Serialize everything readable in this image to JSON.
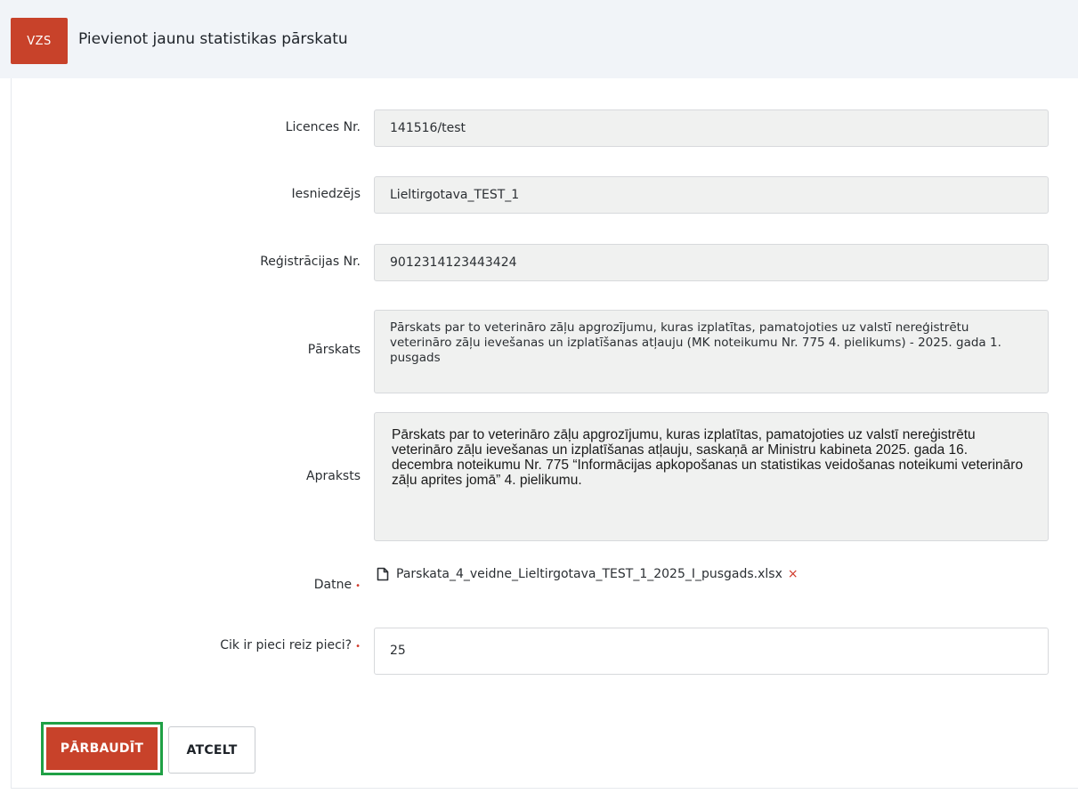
{
  "header": {
    "logo_text": "VZS",
    "title": "Pievienot jaunu statistikas pārskatu"
  },
  "form": {
    "licence": {
      "label": "Licences Nr.",
      "value": "141516/test"
    },
    "submitter": {
      "label": "Iesniedzējs",
      "value": "Lieltirgotava_TEST_1"
    },
    "registration": {
      "label": "Reģistrācijas Nr.",
      "value": "9012314123443424"
    },
    "report": {
      "label": "Pārskats",
      "value": "Pārskats par to veterināro zāļu apgrozījumu, kuras izplatītas, pamatojoties uz valstī nereģistrētu veterināro zāļu ievešanas un izplatīšanas atļauju (MK noteikumu Nr. 775 4. pielikums) - 2025. gada 1. pusgads"
    },
    "description": {
      "label": "Apraksts",
      "value": "Pārskats par to veterināro zāļu apgrozījumu, kuras izplatītas, pamatojoties uz valstī nereģistrētu veterināro zāļu ievešanas un izplatīšanas atļauju, saskaņā ar Ministru kabineta 2025. gada 16. decembra noteikumu Nr. 775 “Informācijas apkopošanas un statistikas veidošanas noteikumi veterināro zāļu aprites jomā” 4. pielikumu."
    },
    "file": {
      "label": "Datne",
      "required_mark": "•",
      "filename": "Parskata_4_veidne_Lieltirgotava_TEST_1_2025_I_pusgads.xlsx",
      "remove_symbol": "×"
    },
    "captcha": {
      "label": "Cik ir pieci reiz pieci?",
      "required_mark": "•",
      "value": "25"
    }
  },
  "actions": {
    "check_label": "PĀRBAUDĪT",
    "cancel_label": "ATCELT"
  },
  "colors": {
    "brand": "#c8422a",
    "focus_outline": "#1fa045",
    "required": "#d0392a"
  },
  "icons": {
    "file": "file-icon",
    "remove": "close-icon"
  }
}
